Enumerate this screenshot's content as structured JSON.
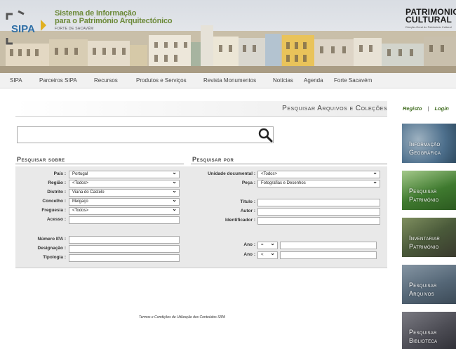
{
  "banner": {
    "sipa_logo_text": "SIPA",
    "title_line1": "Sistema de Informação",
    "title_line2": "para o Património Arquitectónico",
    "subtitle": "FORTE DE SACAVÉM",
    "patrimonio_line1": "PATRIMONIO",
    "patrimonio_line2": "CULTURAL",
    "patrimonio_sub": "Direção-Geral do Património Cultural"
  },
  "nav": {
    "items": [
      "SIPA",
      "Parceiros SIPA",
      "Recursos",
      "Produtos e Serviços",
      "Revista Monumentos",
      "Notícias",
      "Agenda",
      "Forte Sacavém"
    ]
  },
  "main": {
    "title": "Pesquisar Arquivos e Coleções",
    "search_value": ""
  },
  "left": {
    "title": "Pesquisar sobre",
    "fields": [
      {
        "label": "País :",
        "value": "Portugal",
        "type": "select"
      },
      {
        "label": "Região :",
        "value": "<Todos>",
        "type": "select"
      },
      {
        "label": "Distrito :",
        "value": "Viana do Castelo",
        "type": "select"
      },
      {
        "label": "Concelho :",
        "value": "Melgaço",
        "type": "select"
      },
      {
        "label": "Freguesia :",
        "value": "<Todos>",
        "type": "select"
      },
      {
        "label": "Acesso :",
        "value": "",
        "type": "text"
      },
      {
        "label": "Número IPA :",
        "value": "",
        "type": "text"
      },
      {
        "label": "Designação :",
        "value": "",
        "type": "text"
      },
      {
        "label": "Tipologia :",
        "value": "",
        "type": "text"
      }
    ]
  },
  "right": {
    "title": "Pesquisar por",
    "fields": [
      {
        "label": "Unidade documental :",
        "value": "<Todos>",
        "type": "select"
      },
      {
        "label": "Peça :",
        "value": "Fotografias e Desenhos",
        "type": "select"
      },
      {
        "label": "Título :",
        "value": "",
        "type": "text"
      },
      {
        "label": "Autor :",
        "value": "",
        "type": "text"
      },
      {
        "label": "Identificador :",
        "value": "",
        "type": "text"
      },
      {
        "label": "Ano :",
        "op": "=",
        "value": "",
        "type": "year"
      },
      {
        "label": "Ano :",
        "op": "<",
        "value": "",
        "type": "year"
      }
    ]
  },
  "footer": {
    "terms": "Termos e Condições de Utilização dos Conteúdos SIPA"
  },
  "sidebar": {
    "registo": "Registo",
    "separator": "|",
    "login": "Login",
    "tiles": [
      {
        "line1": "Informação",
        "line2": "Geográfica",
        "color": "#4d6f8c"
      },
      {
        "line1": "Pesquisar",
        "line2": "Património",
        "color": "#3f7a2f"
      },
      {
        "line1": "Inventariar",
        "line2": "Património",
        "color": "#4a5a3a"
      },
      {
        "line1": "Pesquisar",
        "line2": "Arquivos",
        "color": "#556777"
      },
      {
        "line1": "Pesquisar",
        "line2": "Biblioteca",
        "color": "#4d4d55"
      }
    ]
  },
  "colors": {
    "sipa_green": "#6d8a3a",
    "sipa_blue": "#2f6fa6",
    "panel_bg": "#e9e9e9"
  },
  "icons": {
    "search": "magnifier-icon"
  }
}
